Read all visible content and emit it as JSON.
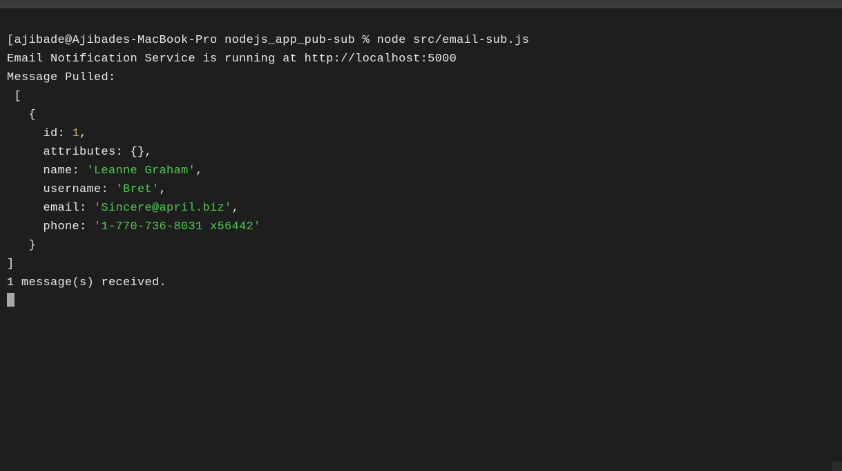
{
  "prompt": {
    "bracket": "[",
    "userhost": "ajibade@Ajibades-MacBook-Pro",
    "cwd": "nodejs_app_pub-sub",
    "symbol": "%",
    "command": "node src/email-sub.js"
  },
  "output": {
    "line1": "Email Notification Service is running at http://localhost:5000",
    "line2": "Message Pulled:",
    "arr_open": " [",
    "obj_open": "   {",
    "id_key": "     id: ",
    "id_val": "1",
    "comma": ",",
    "attr_line": "     attributes: {},",
    "name_key": "     name: ",
    "name_val": "'Leanne Graham'",
    "username_key": "     username: ",
    "username_val": "'Bret'",
    "email_key": "     email: ",
    "email_val": "'Sincere@april.biz'",
    "phone_key": "     phone: ",
    "phone_val": "'1-770-736-8031 x56442'",
    "obj_close": "   }",
    "arr_close": "]",
    "received": "1 message(s) received."
  }
}
